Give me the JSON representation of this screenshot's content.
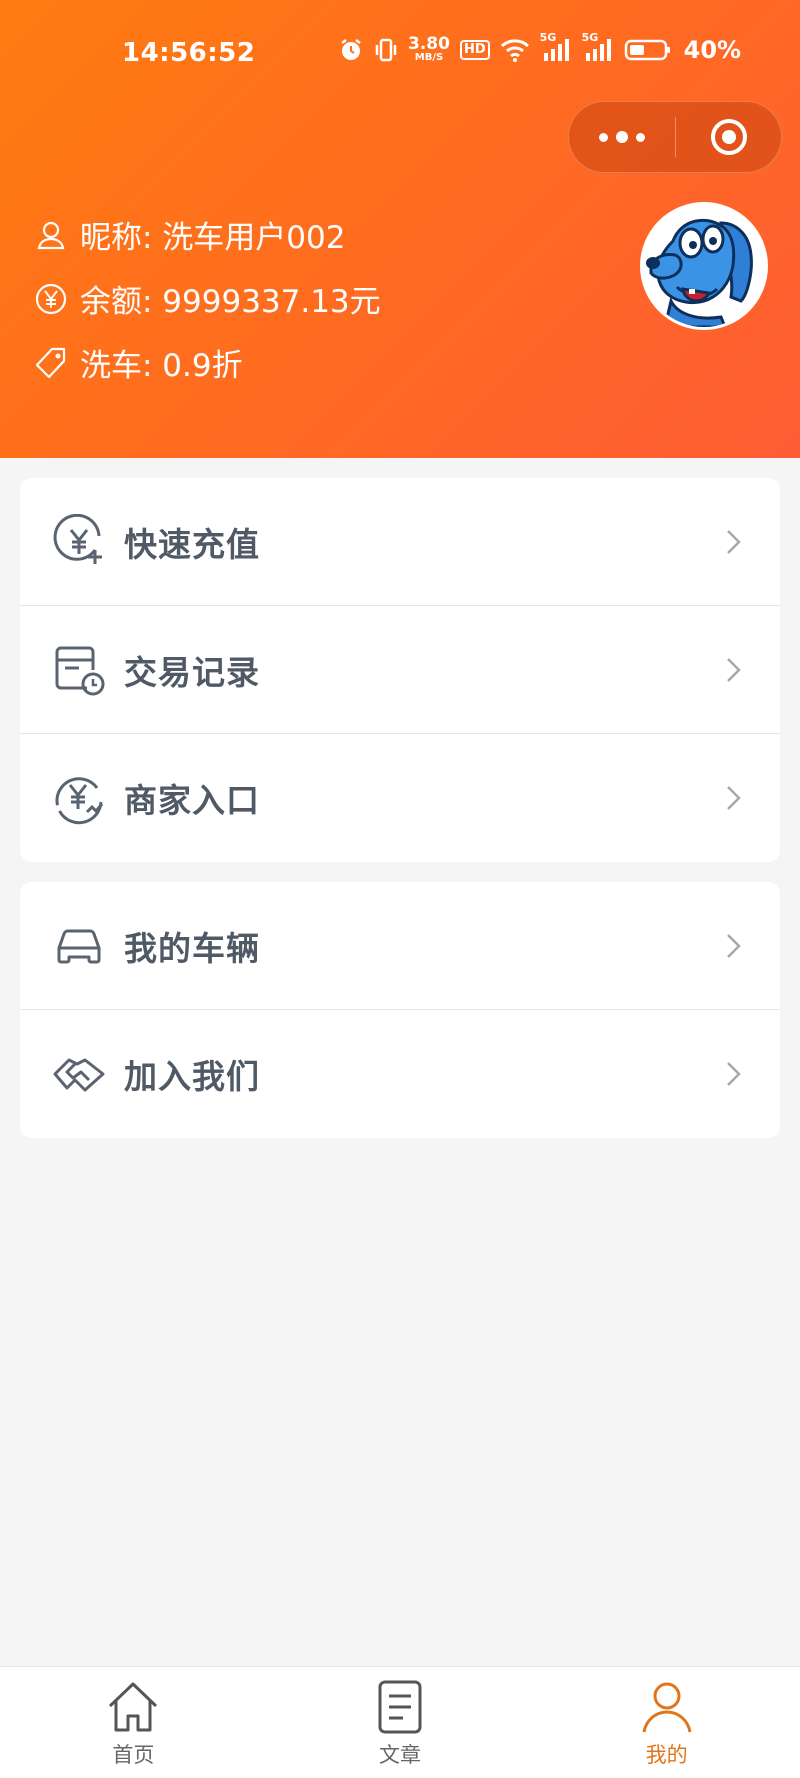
{
  "status_bar": {
    "time": "14:56:52",
    "net_speed_value": "3.80",
    "net_speed_unit": "MB/S",
    "hd_label": "HD",
    "signal1_label": "5G",
    "signal2_label": "5G",
    "battery_percent": "40%",
    "icons": [
      "alarm-icon",
      "vibrate-icon",
      "hd-icon",
      "wifi-icon",
      "signal-icon",
      "signal-icon",
      "battery-icon"
    ]
  },
  "capsule": {
    "icons": [
      "more-dots-icon",
      "close-target-icon"
    ]
  },
  "user": {
    "nickname_line": "昵称: 洗车用户002",
    "balance_line": "余额: 9999337.13元",
    "discount_line": "洗车: 0.9折",
    "avatar_icon": "cartoon-dog-avatar"
  },
  "menu_group_1": [
    {
      "label": "快速充值",
      "icon": "yuan-plus-icon"
    },
    {
      "label": "交易记录",
      "icon": "record-clock-icon"
    },
    {
      "label": "商家入口",
      "icon": "yuan-merchant-icon"
    }
  ],
  "menu_group_2": [
    {
      "label": "我的车辆",
      "icon": "car-icon"
    },
    {
      "label": "加入我们",
      "icon": "handshake-icon"
    }
  ],
  "tabbar": [
    {
      "label": "首页",
      "icon": "home-icon",
      "active": false
    },
    {
      "label": "文章",
      "icon": "article-icon",
      "active": false
    },
    {
      "label": "我的",
      "icon": "user-icon",
      "active": true
    }
  ],
  "colors": {
    "header_start": "#ff7b10",
    "header_end": "#ff5c34",
    "active_tab": "#e0761c",
    "menu_text": "#505a66",
    "icon_gray": "#5a6470"
  }
}
